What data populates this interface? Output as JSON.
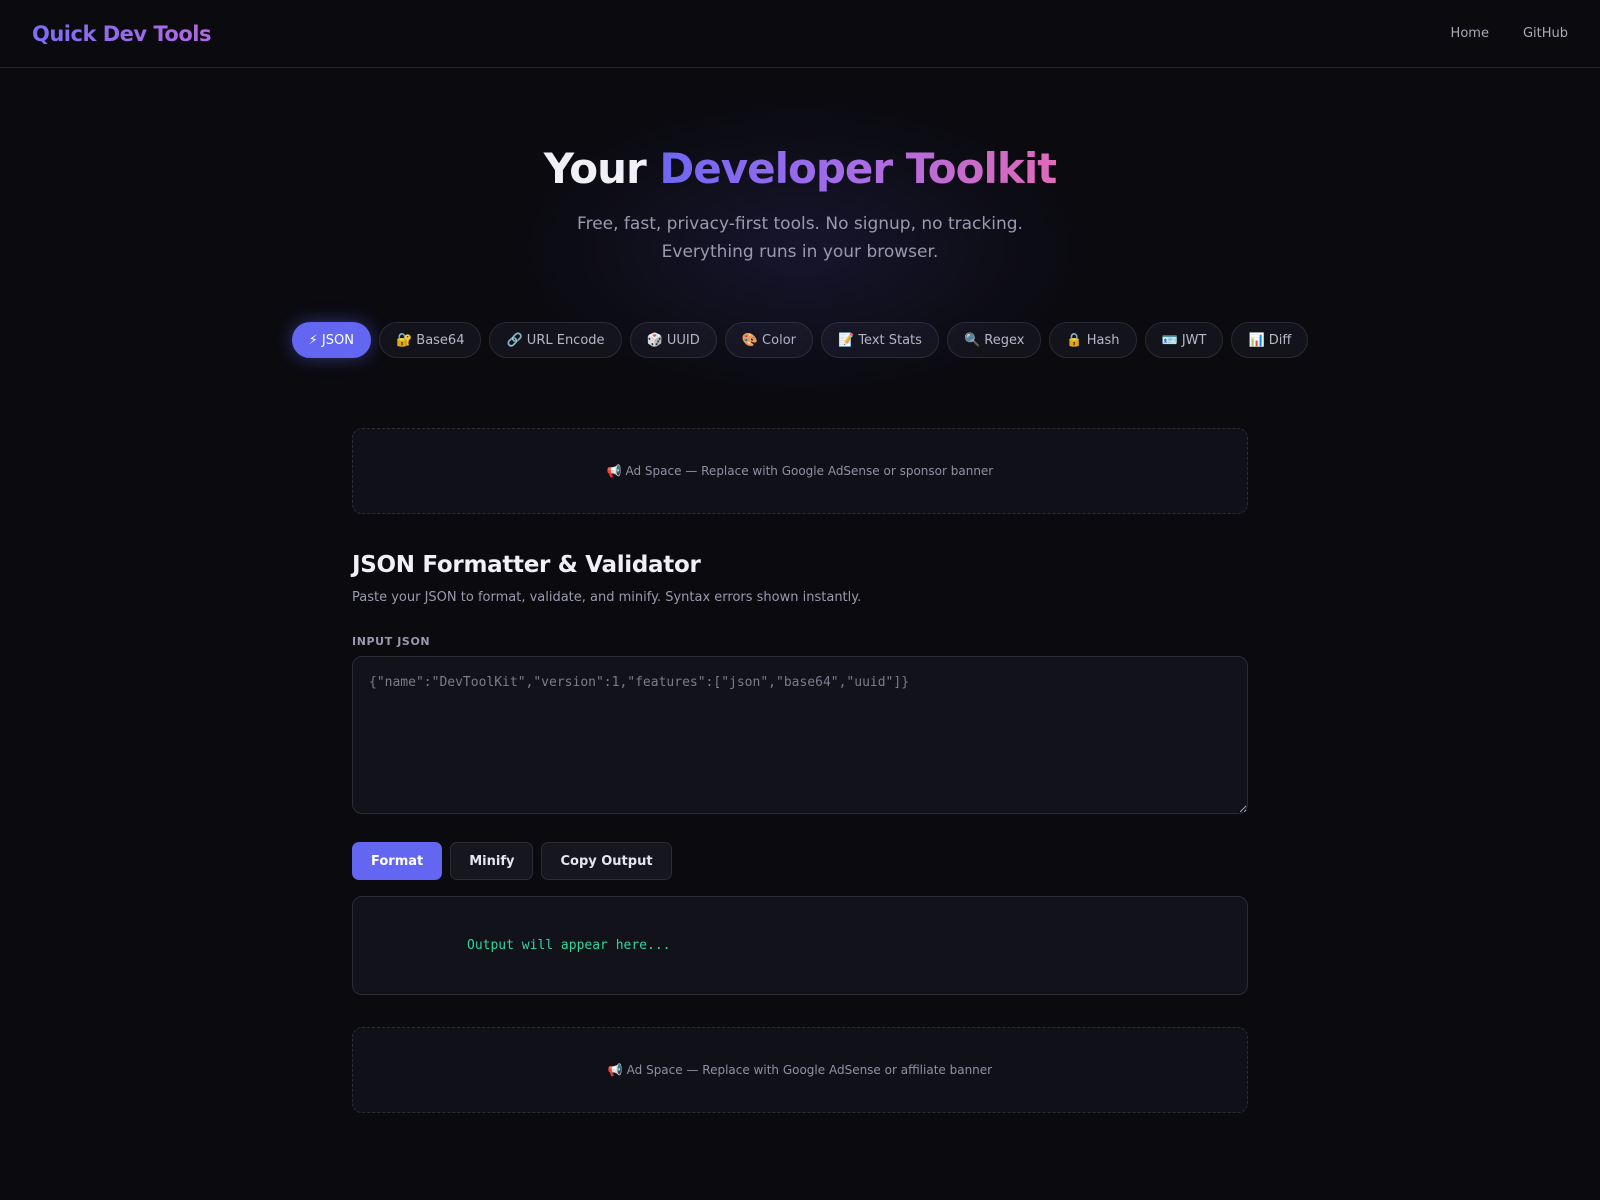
{
  "nav": {
    "brand": "Quick Dev Tools",
    "links": [
      "Home",
      "GitHub"
    ]
  },
  "hero": {
    "title_prefix": "Your ",
    "title_accent": "Developer Toolkit",
    "subtitle": "Free, fast, privacy-first tools. No signup, no tracking. Everything runs in your browser."
  },
  "tabs": [
    {
      "label": "⚡ JSON",
      "active": true
    },
    {
      "label": "🔐 Base64",
      "active": false
    },
    {
      "label": "🔗 URL Encode",
      "active": false
    },
    {
      "label": "🎲 UUID",
      "active": false
    },
    {
      "label": "🎨 Color",
      "active": false
    },
    {
      "label": "📝 Text Stats",
      "active": false
    },
    {
      "label": "🔍 Regex",
      "active": false
    },
    {
      "label": "🔒 Hash",
      "active": false
    },
    {
      "label": "🪪 JWT",
      "active": false
    },
    {
      "label": "📊 Diff",
      "active": false
    }
  ],
  "ads": {
    "top": "📢 Ad Space — Replace with Google AdSense or sponsor banner",
    "bottom": "📢 Ad Space — Replace with Google AdSense or affiliate banner"
  },
  "tool": {
    "title": "JSON Formatter & Validator",
    "description": "Paste your JSON to format, validate, and minify. Syntax errors shown instantly.",
    "input_label": "INPUT JSON",
    "input_placeholder": "{\"name\":\"DevToolKit\",\"version\":1,\"features\":[\"json\",\"base64\",\"uuid\"]}",
    "input_value": "",
    "buttons": {
      "format": "Format",
      "minify": "Minify",
      "copy": "Copy Output"
    },
    "output_placeholder": "Output will appear here..."
  },
  "colors": {
    "accent": "#6366f1",
    "background": "#0a0a0f",
    "output_text": "#34d399"
  }
}
